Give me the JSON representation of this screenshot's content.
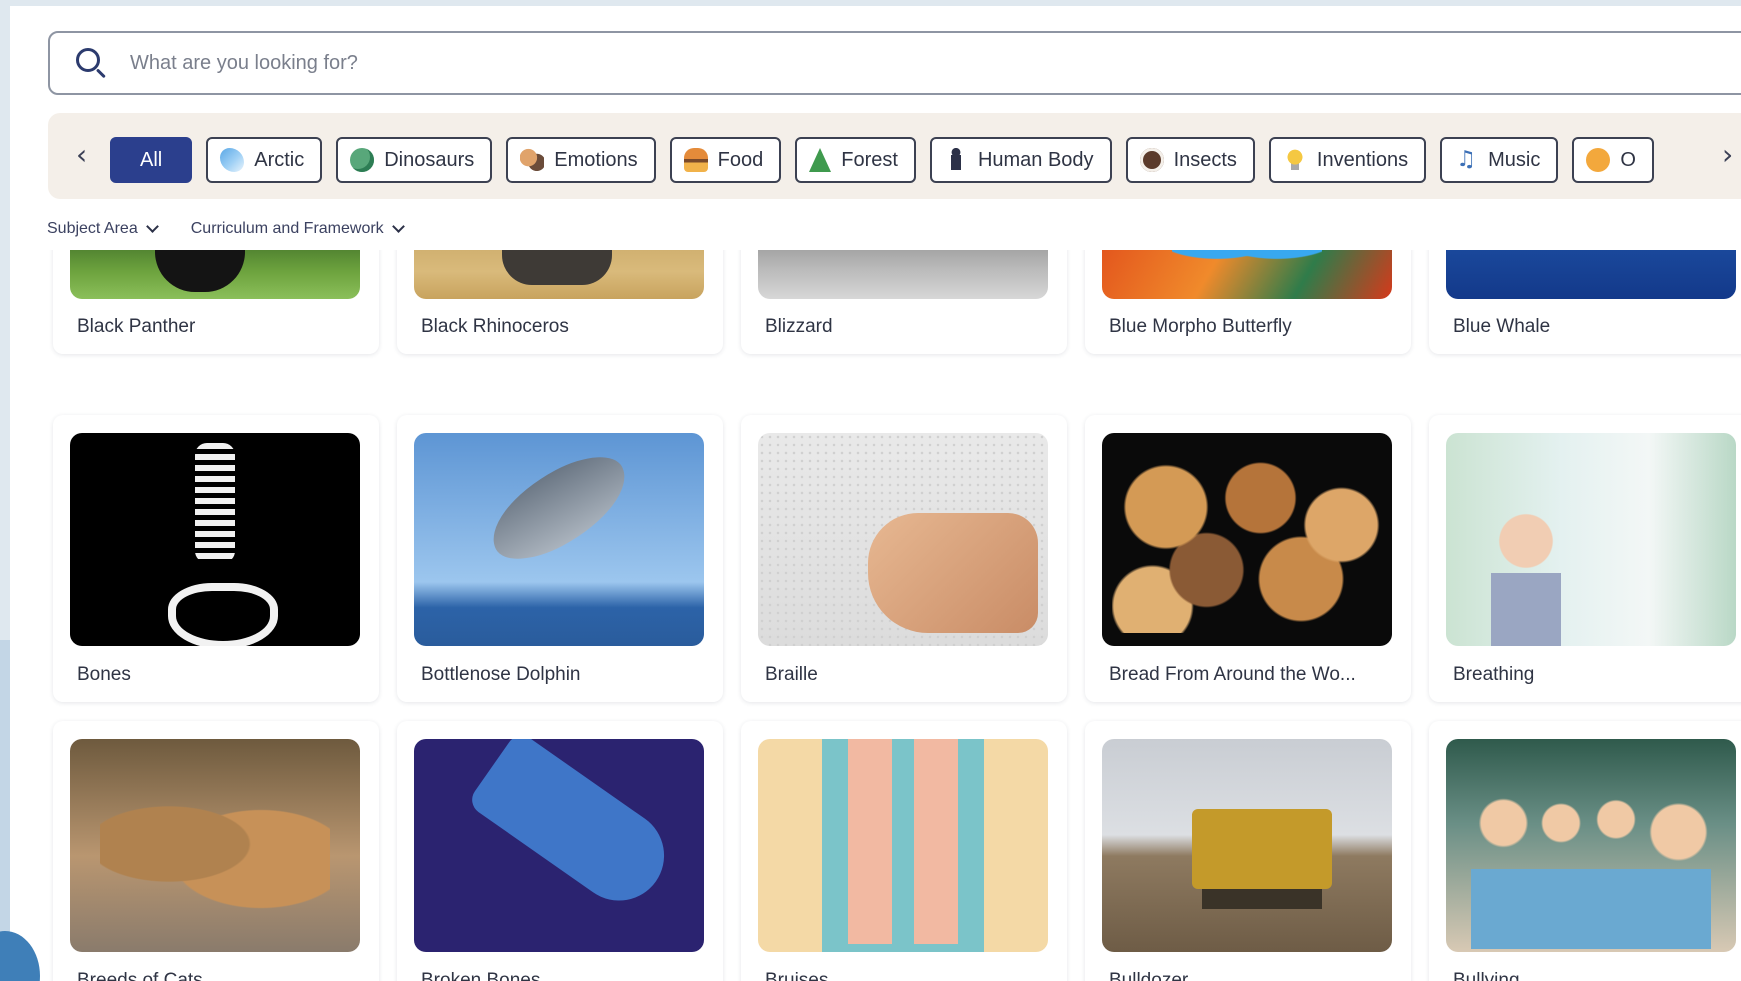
{
  "search": {
    "placeholder": "What are you looking for?"
  },
  "categories": [
    {
      "label": "All",
      "icon": "none",
      "active": true
    },
    {
      "label": "Arctic",
      "icon": "arctic-icon"
    },
    {
      "label": "Dinosaurs",
      "icon": "dinosaur-icon"
    },
    {
      "label": "Emotions",
      "icon": "emotions-icon"
    },
    {
      "label": "Food",
      "icon": "food-icon"
    },
    {
      "label": "Forest",
      "icon": "tree-icon"
    },
    {
      "label": "Human Body",
      "icon": "human-body-icon"
    },
    {
      "label": "Insects",
      "icon": "insect-icon"
    },
    {
      "label": "Inventions",
      "icon": "lightbulb-icon"
    },
    {
      "label": "Music",
      "icon": "music-note-icon"
    },
    {
      "label": "O",
      "icon": "ocean-icon"
    }
  ],
  "filters": {
    "subject_area": "Subject Area",
    "curriculum": "Curriculum and Framework"
  },
  "cards": [
    {
      "title": "Black Panther"
    },
    {
      "title": "Black Rhinoceros"
    },
    {
      "title": "Blizzard"
    },
    {
      "title": "Blue Morpho Butterfly"
    },
    {
      "title": "Blue Whale"
    },
    {
      "title": "Bones"
    },
    {
      "title": "Bottlenose Dolphin"
    },
    {
      "title": "Braille"
    },
    {
      "title": "Bread From Around the Wo..."
    },
    {
      "title": "Breathing"
    },
    {
      "title": "Breeds of Cats"
    },
    {
      "title": "Broken Bones"
    },
    {
      "title": "Bruises"
    },
    {
      "title": "Bulldozer"
    },
    {
      "title": "Bullying"
    }
  ],
  "colors": {
    "accent": "#2b3f8d",
    "category_bar_bg": "#f4efe9",
    "page_bg": "#dfe8ef"
  }
}
